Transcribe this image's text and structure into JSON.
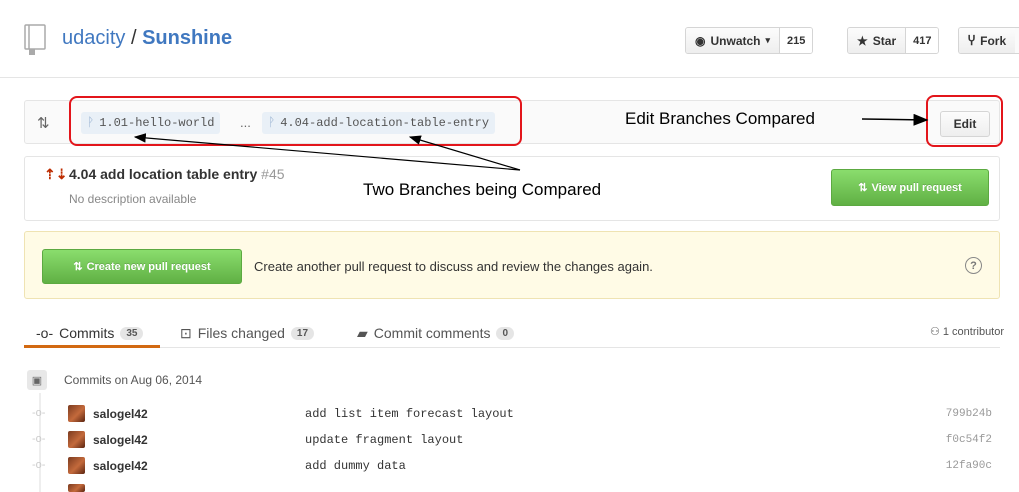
{
  "repo": {
    "owner": "udacity",
    "separator": "/",
    "name": "Sunshine"
  },
  "actions": {
    "unwatch": {
      "label": "Unwatch",
      "count": "215"
    },
    "star": {
      "label": "Star",
      "count": "417"
    },
    "fork": {
      "label": "Fork"
    }
  },
  "compare": {
    "base_branch": "1.01-hello-world",
    "separator": "...",
    "head_branch": "4.04-add-location-table-entry",
    "edit_label": "Edit"
  },
  "pull_request": {
    "title": "4.04 add location table entry",
    "number": "#45",
    "description": "No description available",
    "view_label": "View pull request"
  },
  "create_pr": {
    "button_label": "Create new pull request",
    "text": "Create another pull request to discuss and review the changes again.",
    "help": "?"
  },
  "tabs": [
    {
      "label": "Commits",
      "count": "35"
    },
    {
      "label": "Files changed",
      "count": "17"
    },
    {
      "label": "Commit comments",
      "count": "0"
    }
  ],
  "contributors": "1 contributor",
  "commits_day": "Commits on Aug 06, 2014",
  "commits": [
    {
      "author": "salogel42",
      "message": "add list item forecast layout",
      "sha": "799b24b"
    },
    {
      "author": "salogel42",
      "message": "update fragment layout",
      "sha": "f0c54f2"
    },
    {
      "author": "salogel42",
      "message": "add dummy data",
      "sha": "12fa90c"
    }
  ],
  "annotations": {
    "edit_note": "Edit Branches Compared",
    "branches_note": "Two Branches being Compared",
    "highlight_color": "#e3151b"
  },
  "colors": {
    "link": "#4078c0",
    "green": "#60b044",
    "active_tab": "#d26911"
  },
  "icons": [
    "repo-icon",
    "eye-icon",
    "star-icon",
    "fork-icon",
    "compare-icon",
    "branch-icon",
    "pull-request-icon",
    "help-icon",
    "commit-icon",
    "file-diff-icon",
    "comment-icon",
    "contributors-icon",
    "commit-day-icon",
    "commit-node-icon",
    "avatar"
  ]
}
